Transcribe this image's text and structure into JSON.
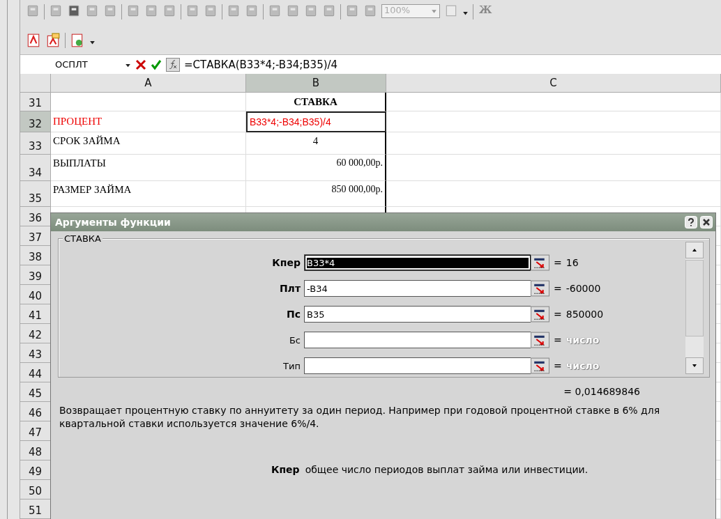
{
  "toolbar": {
    "zoom": "100%",
    "bold_button": "Ж"
  },
  "formula_bar": {
    "name_box": "ОСПЛТ",
    "formula": "=СТАВКА(B33*4;-B34;B35)/4"
  },
  "sheet": {
    "columns": [
      {
        "label": "A",
        "selected": false
      },
      {
        "label": "B",
        "selected": true
      },
      {
        "label": "C",
        "selected": false
      }
    ],
    "rows": [
      {
        "number": "31",
        "selected": false,
        "b": {
          "text": "СТАВКА",
          "kind": "heading"
        }
      },
      {
        "number": "32",
        "selected": true,
        "a": {
          "text": "ПРОЦЕНТ",
          "kind": "highlight"
        },
        "b": {
          "text": "B33*4;-B34;B35)/4",
          "kind": "edit"
        }
      },
      {
        "number": "33",
        "selected": false,
        "a": {
          "text": "СРОК ЗАЙМА",
          "kind": "label"
        },
        "b": {
          "text": "4",
          "kind": "center"
        }
      },
      {
        "number": "34",
        "selected": false,
        "a": {
          "text": "ВЫПЛАТЫ",
          "kind": "label"
        },
        "b": {
          "text": "60 000,00р.",
          "kind": "money"
        }
      },
      {
        "number": "35",
        "selected": false,
        "a": {
          "text": "РАЗМЕР ЗАЙМА",
          "kind": "label"
        },
        "b": {
          "text": "850 000,00р.",
          "kind": "money"
        }
      },
      {
        "number": "36",
        "selected": false
      },
      {
        "number": "37",
        "selected": false
      },
      {
        "number": "38",
        "selected": false
      },
      {
        "number": "39",
        "selected": false
      },
      {
        "number": "40",
        "selected": false
      },
      {
        "number": "41",
        "selected": false
      },
      {
        "number": "42",
        "selected": false
      },
      {
        "number": "43",
        "selected": false
      },
      {
        "number": "44",
        "selected": false
      },
      {
        "number": "45",
        "selected": false
      },
      {
        "number": "46",
        "selected": false
      },
      {
        "number": "47",
        "selected": false
      },
      {
        "number": "48",
        "selected": false
      },
      {
        "number": "49",
        "selected": false
      },
      {
        "number": "50",
        "selected": false
      },
      {
        "number": "51",
        "selected": false
      }
    ]
  },
  "dialog": {
    "title": "Аргументы функции",
    "group": "СТАВКА",
    "arguments": [
      {
        "label": "Кпер",
        "required": true,
        "value": "B33*4",
        "selected": true,
        "equals": "=",
        "result": "16"
      },
      {
        "label": "Плт",
        "required": true,
        "value": "-B34",
        "selected": false,
        "equals": "=",
        "result": "-60000"
      },
      {
        "label": "Пс",
        "required": true,
        "value": "B35",
        "selected": false,
        "equals": "=",
        "result": "850000"
      },
      {
        "label": "Бс",
        "required": false,
        "selected": false,
        "equals": "=",
        "hint": "число"
      },
      {
        "label": "Тип",
        "required": false,
        "selected": false,
        "equals": "=",
        "hint": "число"
      }
    ],
    "result": "= 0,014689846",
    "description": "Возвращает процентную ставку по аннуитету за один период. Например при годовой процентной ставке в 6% для квартальной ставки используется значение 6%/4.",
    "help": {
      "term": "Кпер",
      "text": "общее число периодов выплат займа или инвестиции."
    }
  }
}
